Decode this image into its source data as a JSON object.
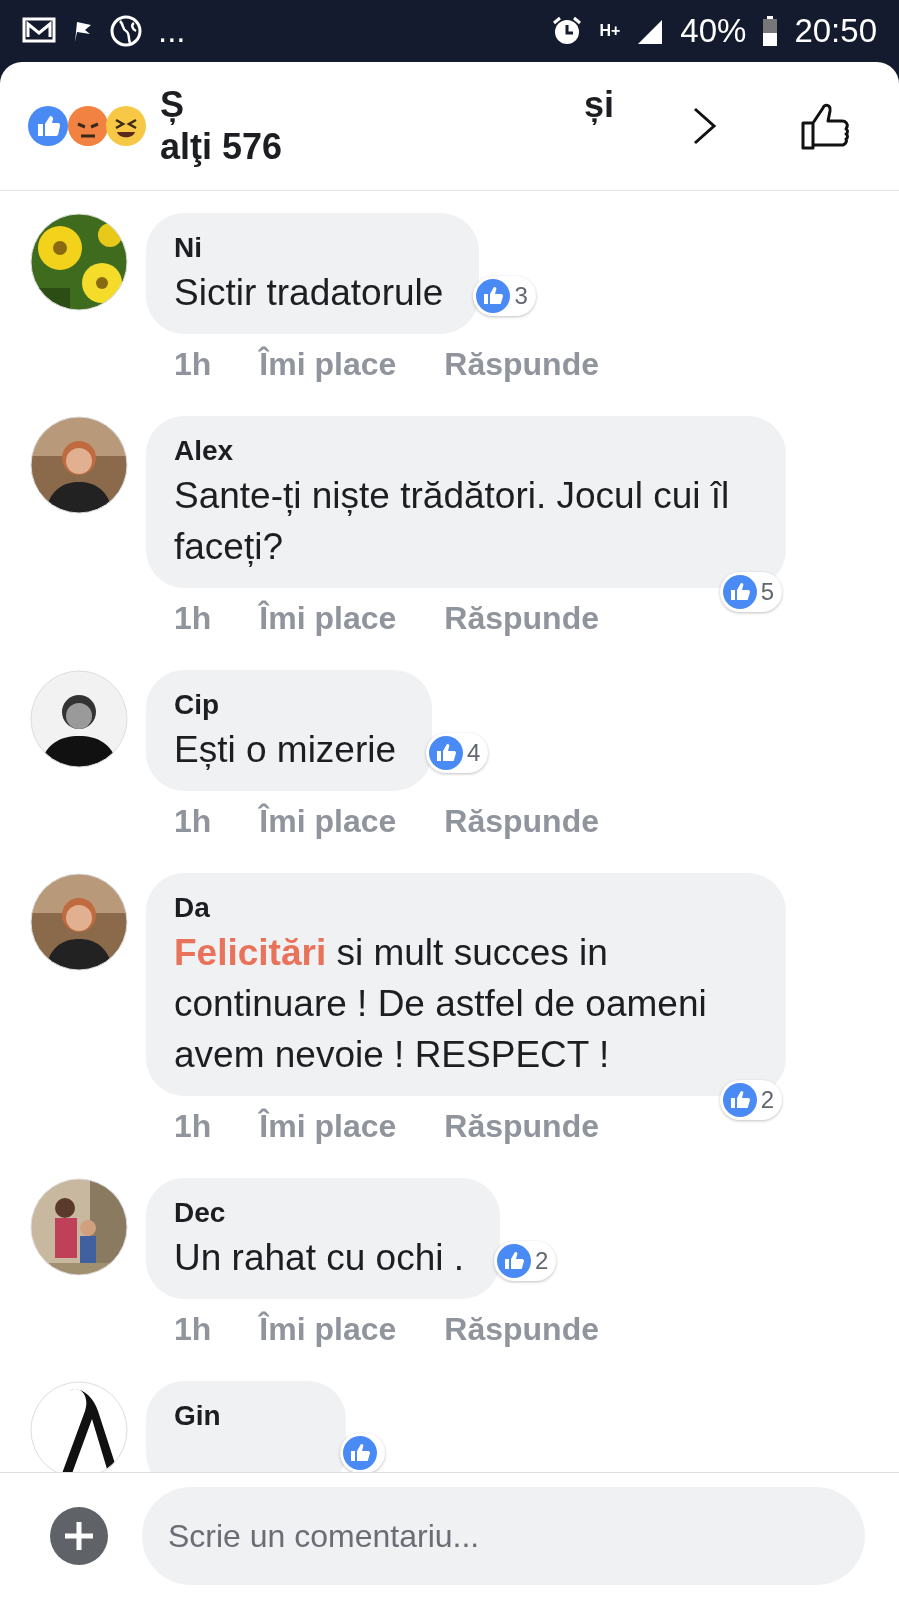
{
  "status_bar": {
    "time": "20:50",
    "battery": "40%",
    "network": "H+",
    "more": "..."
  },
  "header": {
    "title_start": "Ș",
    "title_end": "și",
    "title_line2": "alţi 576"
  },
  "comments": [
    {
      "name": "Ni",
      "body": "Sictir tradatorule",
      "likes": "3",
      "kind": "short",
      "time": "1h",
      "like_label": "Îmi place",
      "reply_label": "Răspunde"
    },
    {
      "name": "Alex",
      "body": "Sante-ți  niște  trădători. Jocul cui îl faceți?",
      "likes": "5",
      "kind": "long",
      "time": "1h",
      "like_label": "Îmi place",
      "reply_label": "Răspunde"
    },
    {
      "name": "Cip",
      "body": "Ești o mizerie",
      "likes": "4",
      "kind": "short",
      "time": "1h",
      "like_label": "Îmi place",
      "reply_label": "Răspunde"
    },
    {
      "name": "Da",
      "tag": "Felicitări",
      "body": " si mult succes in continuare  ! De astfel de oameni avem nevoie ! RESPECT !",
      "likes": "2",
      "kind": "long",
      "time": "1h",
      "like_label": "Îmi place",
      "reply_label": "Răspunde"
    },
    {
      "name": "Dec",
      "body": "Un rahat cu ochi .",
      "likes": "2",
      "kind": "short",
      "time": "1h",
      "like_label": "Îmi place",
      "reply_label": "Răspunde"
    },
    {
      "name": "Gin",
      "kind": "short"
    }
  ],
  "composer": {
    "placeholder": "Scrie un comentariu..."
  }
}
